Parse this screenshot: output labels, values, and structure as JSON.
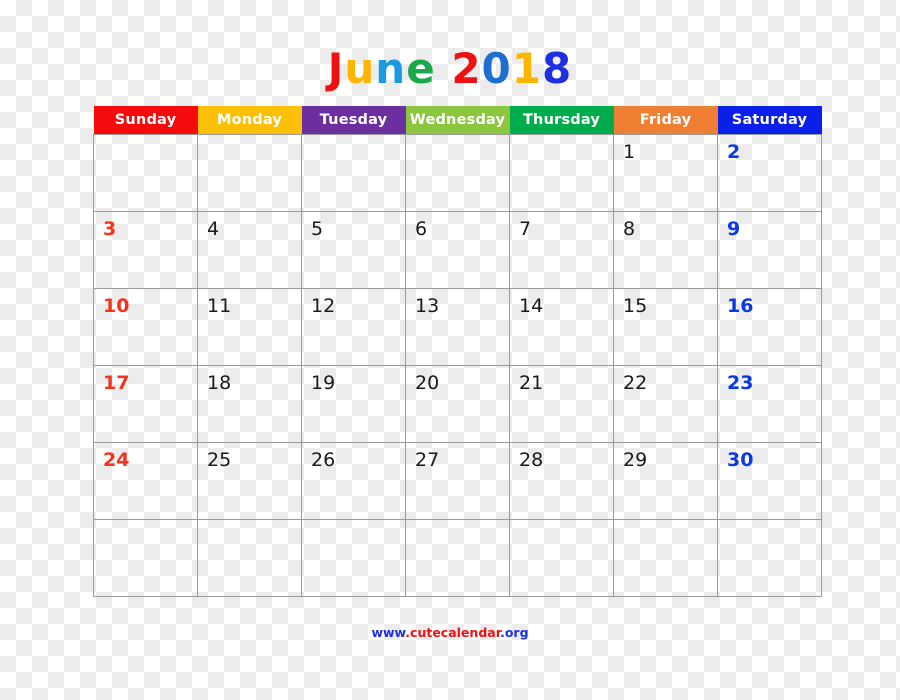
{
  "title": {
    "text": "June 2018",
    "letters": [
      {
        "ch": "J",
        "color": "#ee1111"
      },
      {
        "ch": "u",
        "color": "#ffb400"
      },
      {
        "ch": "n",
        "color": "#1a9ae0"
      },
      {
        "ch": "e",
        "color": "#1aa84a"
      },
      {
        "ch": " ",
        "color": "#000000"
      },
      {
        "ch": "2",
        "color": "#ee1111"
      },
      {
        "ch": "0",
        "color": "#1d6fd0"
      },
      {
        "ch": "1",
        "color": "#ffb400"
      },
      {
        "ch": "8",
        "color": "#1d2fe0"
      }
    ]
  },
  "header": {
    "days": [
      {
        "label": "Sunday",
        "bg": "#f50b0b"
      },
      {
        "label": "Monday",
        "bg": "#fdc009"
      },
      {
        "label": "Tuesday",
        "bg": "#6b2fa0"
      },
      {
        "label": "Wednesday",
        "bg": "#8cc63e"
      },
      {
        "label": "Thursday",
        "bg": "#00ac4e"
      },
      {
        "label": "Friday",
        "bg": "#ee7f33"
      },
      {
        "label": "Saturday",
        "bg": "#0a1fe8"
      }
    ]
  },
  "colors": {
    "sunday_date": "#f4331c",
    "saturday_date": "#0a3adf",
    "weekday_date": "#1a1a1a",
    "grid_line": "#9a9a9a"
  },
  "weeks": [
    [
      {
        "day": "",
        "kind": "empty"
      },
      {
        "day": "",
        "kind": "empty"
      },
      {
        "day": "",
        "kind": "empty"
      },
      {
        "day": "",
        "kind": "empty"
      },
      {
        "day": "",
        "kind": "empty"
      },
      {
        "day": "1",
        "kind": "weekday"
      },
      {
        "day": "2",
        "kind": "saturday"
      }
    ],
    [
      {
        "day": "3",
        "kind": "sunday"
      },
      {
        "day": "4",
        "kind": "weekday"
      },
      {
        "day": "5",
        "kind": "weekday"
      },
      {
        "day": "6",
        "kind": "weekday"
      },
      {
        "day": "7",
        "kind": "weekday"
      },
      {
        "day": "8",
        "kind": "weekday"
      },
      {
        "day": "9",
        "kind": "saturday"
      }
    ],
    [
      {
        "day": "10",
        "kind": "sunday"
      },
      {
        "day": "11",
        "kind": "weekday"
      },
      {
        "day": "12",
        "kind": "weekday"
      },
      {
        "day": "13",
        "kind": "weekday"
      },
      {
        "day": "14",
        "kind": "weekday"
      },
      {
        "day": "15",
        "kind": "weekday"
      },
      {
        "day": "16",
        "kind": "saturday"
      }
    ],
    [
      {
        "day": "17",
        "kind": "sunday"
      },
      {
        "day": "18",
        "kind": "weekday"
      },
      {
        "day": "19",
        "kind": "weekday"
      },
      {
        "day": "20",
        "kind": "weekday"
      },
      {
        "day": "21",
        "kind": "weekday"
      },
      {
        "day": "22",
        "kind": "weekday"
      },
      {
        "day": "23",
        "kind": "saturday"
      }
    ],
    [
      {
        "day": "24",
        "kind": "sunday"
      },
      {
        "day": "25",
        "kind": "weekday"
      },
      {
        "day": "26",
        "kind": "weekday"
      },
      {
        "day": "27",
        "kind": "weekday"
      },
      {
        "day": "28",
        "kind": "weekday"
      },
      {
        "day": "29",
        "kind": "weekday"
      },
      {
        "day": "30",
        "kind": "saturday"
      }
    ],
    [
      {
        "day": "",
        "kind": "empty"
      },
      {
        "day": "",
        "kind": "empty"
      },
      {
        "day": "",
        "kind": "empty"
      },
      {
        "day": "",
        "kind": "empty"
      },
      {
        "day": "",
        "kind": "empty"
      },
      {
        "day": "",
        "kind": "empty"
      },
      {
        "day": "",
        "kind": "empty"
      }
    ]
  ],
  "footer": {
    "url": "www.cutecalendar.org",
    "parts": [
      {
        "text": "www",
        "color": "#1d2fe0"
      },
      {
        "text": ".",
        "color": "#ee1111"
      },
      {
        "text": "cutecalendar",
        "color": "#ee1111"
      },
      {
        "text": ".",
        "color": "#1d2fe0"
      },
      {
        "text": "org",
        "color": "#1d2fe0"
      }
    ]
  }
}
